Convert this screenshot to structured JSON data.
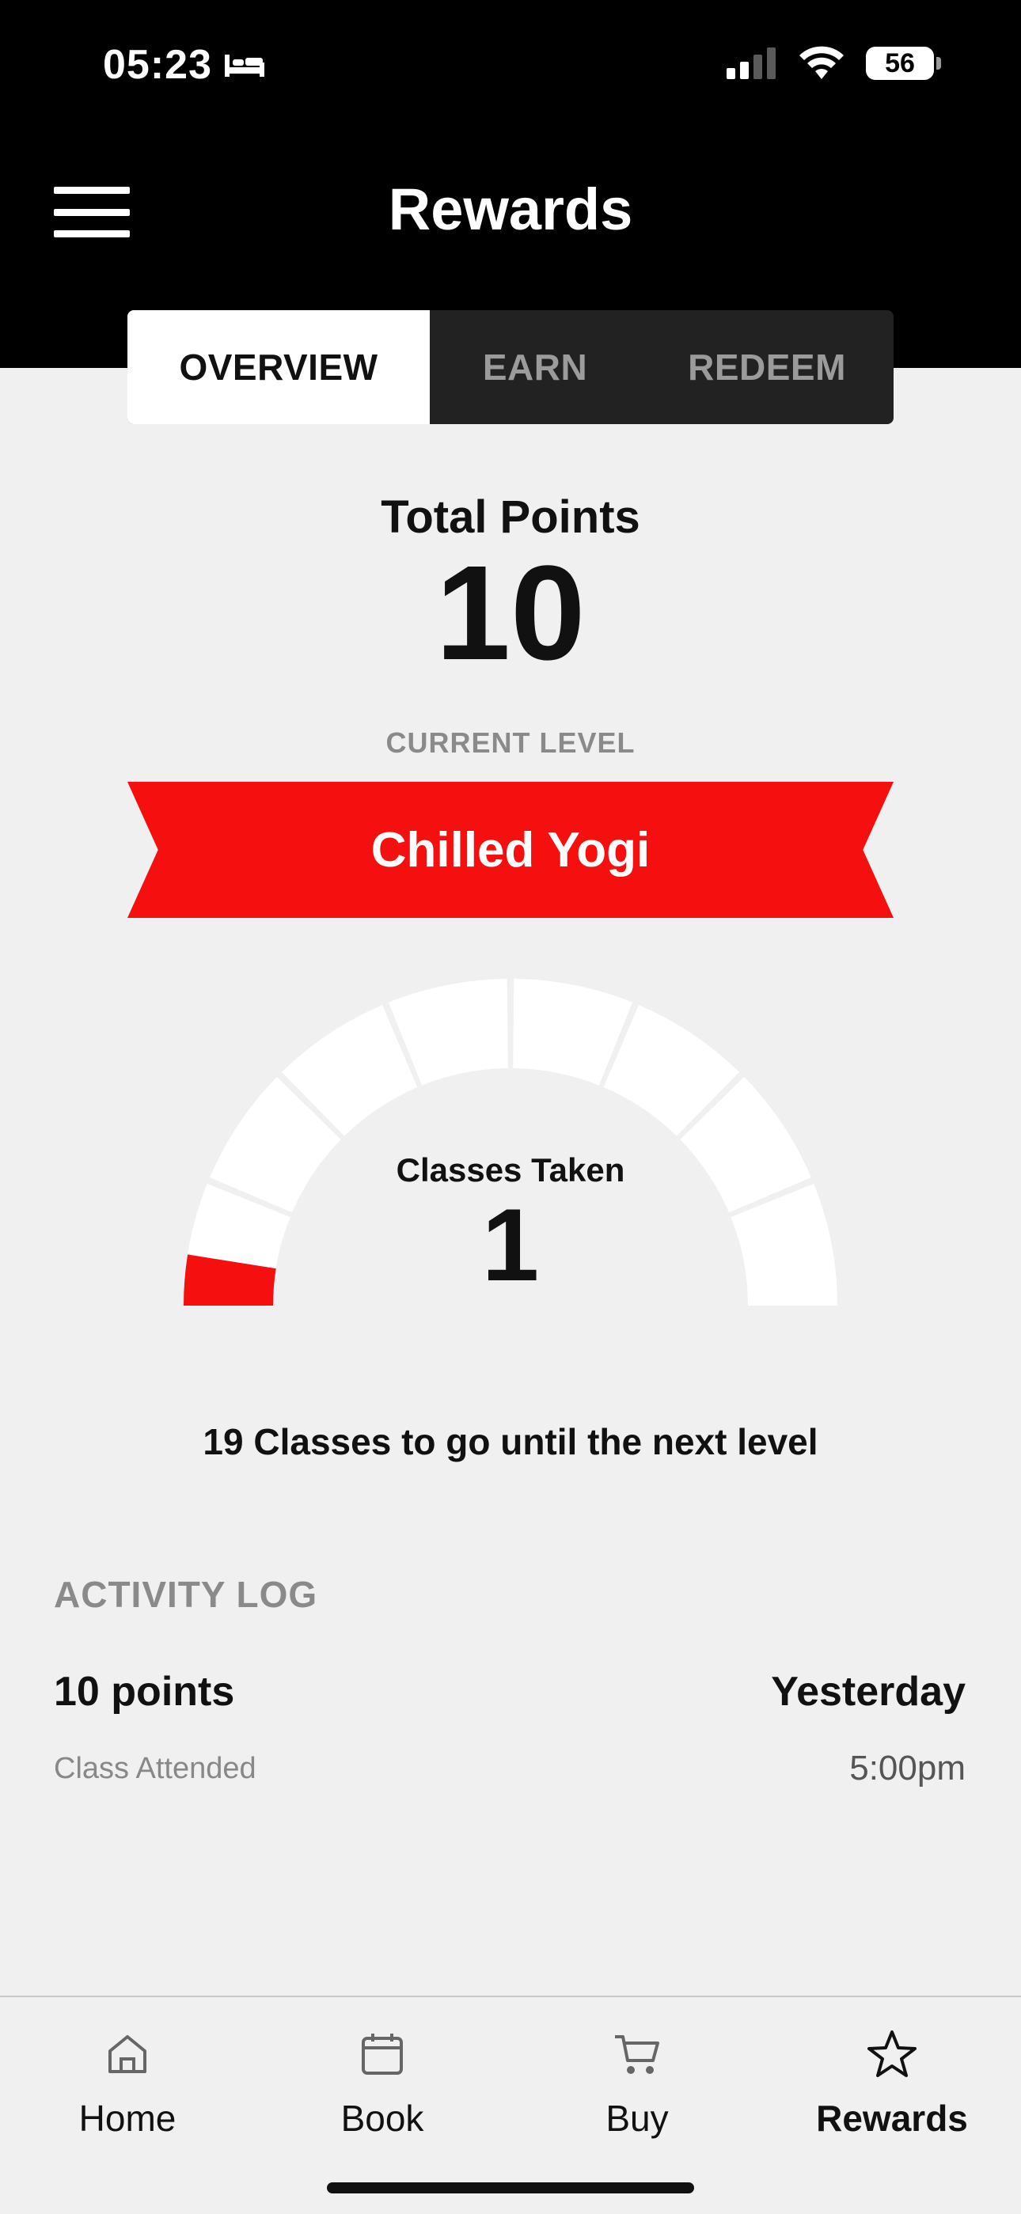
{
  "status_bar": {
    "time": "05:23",
    "battery": "56"
  },
  "header": {
    "title": "Rewards"
  },
  "tabs": [
    {
      "label": "OVERVIEW",
      "active": true
    },
    {
      "label": "EARN",
      "active": false
    },
    {
      "label": "REDEEM",
      "active": false
    }
  ],
  "points": {
    "label": "Total Points",
    "value": "10"
  },
  "level": {
    "label": "CURRENT LEVEL",
    "name": "Chilled Yogi"
  },
  "gauge": {
    "label": "Classes Taken",
    "value": "1",
    "segments": 8,
    "filled_fraction": 0.05
  },
  "progress_text": "19 Classes to go until the next level",
  "activity": {
    "title": "ACTIVITY LOG",
    "entries": [
      {
        "points": "10 points",
        "date": "Yesterday",
        "description": "Class Attended",
        "time": "5:00pm"
      }
    ]
  },
  "nav": [
    {
      "label": "Home",
      "icon": "home-icon",
      "active": false
    },
    {
      "label": "Book",
      "icon": "calendar-icon",
      "active": false
    },
    {
      "label": "Buy",
      "icon": "cart-icon",
      "active": false
    },
    {
      "label": "Rewards",
      "icon": "star-icon",
      "active": true
    }
  ],
  "colors": {
    "accent": "#f50f0f",
    "header_bg": "#000000",
    "page_bg": "#f0f0f0",
    "tab_bg": "#222222"
  }
}
